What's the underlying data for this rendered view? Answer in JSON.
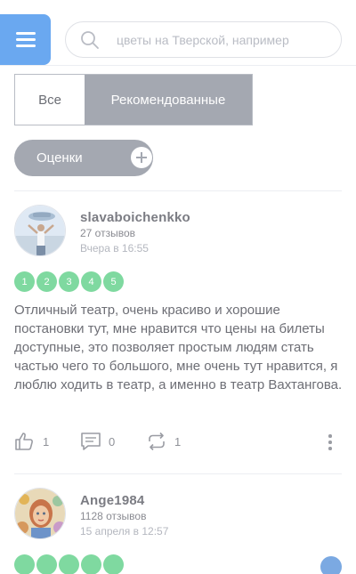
{
  "search": {
    "placeholder": "цветы на Тверской, например"
  },
  "filters": {
    "all_label": "Все",
    "recommended_label": "Рекомендованные",
    "ratings_label": "Оценки"
  },
  "reviews": [
    {
      "username": "slavaboichenkko",
      "reviews_count": "27 отзывов",
      "date": "Вчера в 16:55",
      "rating_steps": [
        "1",
        "2",
        "3",
        "4",
        "5"
      ],
      "text": "Отличный театр, очень красиво и хорошие постановки тут, мне нравится что цены на билеты доступные, это позволяет простым людям стать частью чего то большого, мне очень тут нравится, я люблю ходить в театр, а именно в театр Вахтангова.",
      "likes": "1",
      "comments": "0",
      "reposts": "1"
    },
    {
      "username": "Ange1984",
      "reviews_count": "1128 отзывов",
      "date": "15 апреля в 12:57"
    }
  ],
  "colors": {
    "menu_button": "#6aa8f0",
    "segment_active": "#a4a8b1",
    "rating_pill": "#7fd9a0"
  }
}
